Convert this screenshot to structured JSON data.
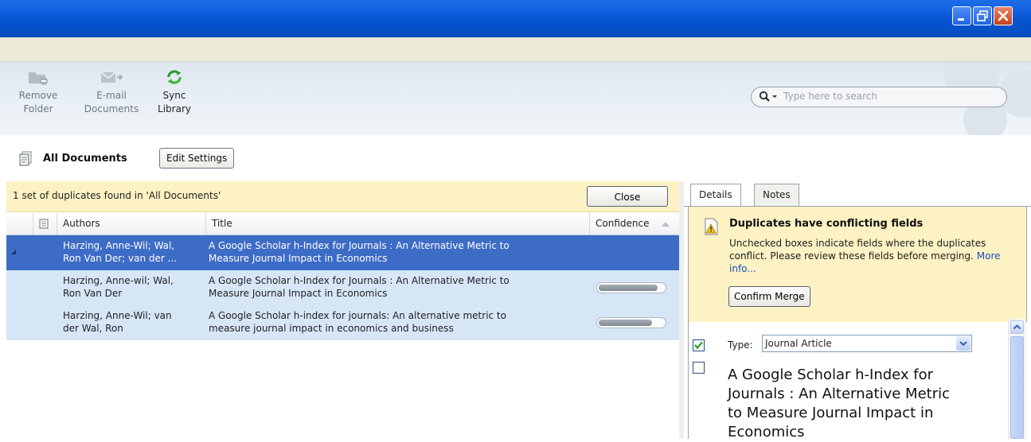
{
  "toolbar": {
    "remove_folder": {
      "line1": "Remove",
      "line2": "Folder"
    },
    "email_documents": {
      "line1": "E-mail",
      "line2": "Documents"
    },
    "sync_library": {
      "line1": "Sync",
      "line2": "Library"
    }
  },
  "search": {
    "placeholder": "Type here to search"
  },
  "section": {
    "title": "All Documents",
    "edit_settings": "Edit Settings"
  },
  "duplicates_bar": {
    "message": "1 set of duplicates found in 'All Documents'",
    "close": "Close"
  },
  "columns": {
    "authors": "Authors",
    "title": "Title",
    "confidence": "Confidence"
  },
  "rows": [
    {
      "authors_l1": "Harzing, Anne-Wil; Wal,",
      "authors_l2": "Ron Van Der; van der ...",
      "title_l1": "A Google Scholar h-Index for Journals : An Alternative Metric to",
      "title_l2": "Measure Journal Impact in Economics",
      "selected": true
    },
    {
      "authors_l1": "Harzing, Anne-wil; Wal,",
      "authors_l2": "Ron Van Der",
      "title_l1": "A Google Scholar h-Index for Journals : An Alternative Metric to",
      "title_l2": "Measure Journal Impact in Economics",
      "confidence": 0.9
    },
    {
      "authors_l1": "Harzing, Anne-Wil; van",
      "authors_l2": "der Wal, Ron",
      "title_l1": "A Google Scholar h-index for journals: An alternative metric to",
      "title_l2": "measure journal impact in economics and business",
      "confidence": 0.82
    }
  ],
  "tabs": {
    "details": "Details",
    "notes": "Notes"
  },
  "conflict": {
    "heading": "Duplicates have conflicting fields",
    "body": "Unchecked boxes indicate fields where the duplicates conflict. Please review these fields before merging.",
    "more_info": "More info...",
    "confirm": "Confirm Merge"
  },
  "details": {
    "type_label": "Type:",
    "type_value": "Journal Article",
    "type_checked": true,
    "title_checked": false,
    "title": "A Google Scholar h-Index for Journals : An Alternative Metric to Measure Journal Impact in Economics"
  },
  "icons": [
    "minimize-icon",
    "restore-icon",
    "close-icon",
    "remove-folder-icon",
    "email-icon",
    "sync-icon",
    "search-icon",
    "documents-icon",
    "sort-up-icon",
    "document-column-icon",
    "warning-icon",
    "checkbox-icon",
    "dropdown-icon"
  ],
  "colors": {
    "selected_row": "#3d6cc6",
    "alt_row": "#d7e6f7",
    "notice_bg": "#fcf2c4",
    "titlebar": "#0a58d8"
  }
}
